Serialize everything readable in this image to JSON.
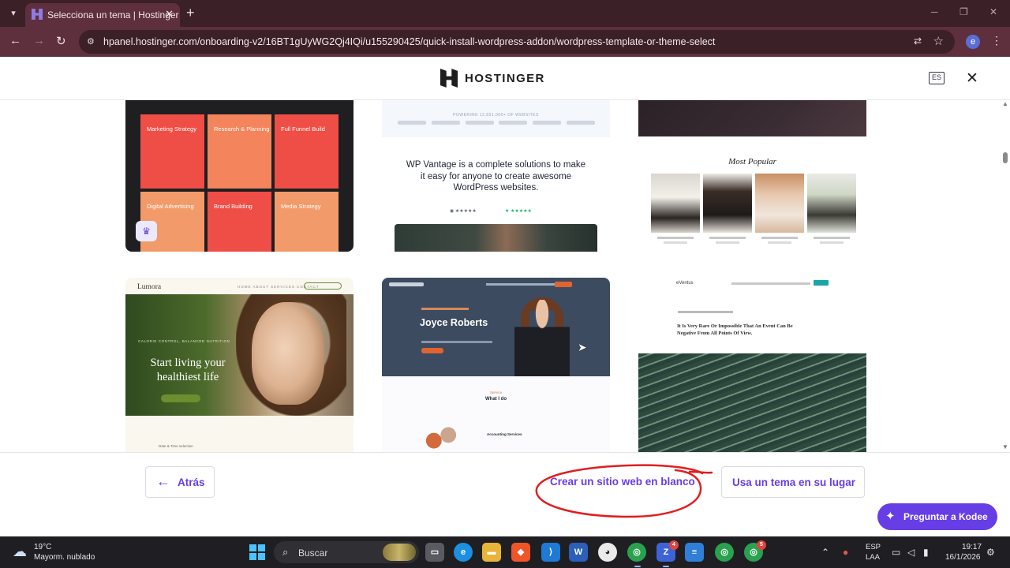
{
  "browser": {
    "tab_title": "Selecciona un tema | Hostinger",
    "url": "hpanel.hostinger.com/onboarding-v2/16BT1gUyWG2Qj4IQi/u155290425/quick-install-wordpress-addon/wordpress-template-or-theme-select",
    "profile_initial": "e"
  },
  "header": {
    "logo_text": "HOSTINGER",
    "language_badge": "ES"
  },
  "cards": {
    "agency": {
      "tiles": [
        "Marketing Strategy",
        "Research & Planning",
        "Full Funnel Build",
        "Digital Advertising",
        "Brand Building",
        "Media Strategy"
      ],
      "premium_icon": "crown-icon"
    },
    "wp_vantage": {
      "topline": "POWERING 12,831,000+ OF WEBSITES",
      "headline": "WP Vantage is a complete solutions to make it easy for anyone to create awesome WordPress websites."
    },
    "fashion": {
      "section_title": "Most Popular"
    },
    "lumora": {
      "brand": "Lumora",
      "nav": "HOME   ABOUT   SERVICES   CONTACT",
      "kicker": "CALORIE CONTROL, BALANCED NUTRITION",
      "heading": "Start living your healthiest life",
      "footer_note": "Date & Time selection"
    },
    "joyce": {
      "name": "Joyce Roberts",
      "services_kicker": "Service",
      "services_title": "What I do",
      "service_item": "Accounting Services"
    },
    "ventus": {
      "brand": "eVentus",
      "heading": "It Is Very Rare Or Impossible That An Event Can Be Negative From All Points Of View."
    }
  },
  "actions": {
    "back_label": "Atrás",
    "blank_label": "Crear un sitio web en blanco",
    "theme_label": "Usa un tema en su lugar",
    "kodee_label": "Preguntar a Kodee",
    "annotation_color": "#e01f1f",
    "accent_color": "#673de6"
  },
  "taskbar": {
    "weather_temp": "19°C",
    "weather_desc": "Mayorm. nublado",
    "search_label": "Buscar",
    "lang_line1": "ESP",
    "lang_line2": "LAA",
    "time": "19:17",
    "date": "16/1/2026"
  }
}
